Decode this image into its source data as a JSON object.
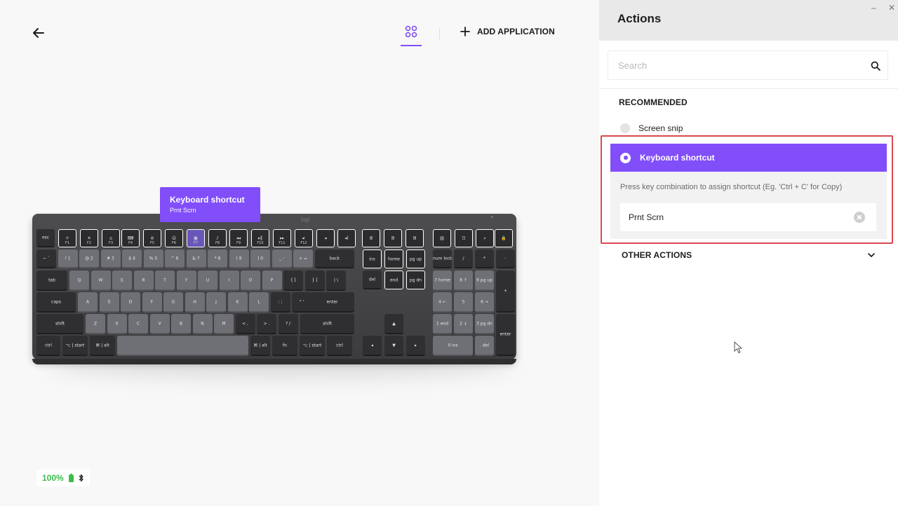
{
  "header": {
    "add_application_label": "ADD APPLICATION"
  },
  "battery": {
    "percent": "100%",
    "color": "#3cbc4c"
  },
  "keyboard": {
    "brand_logo": "logi",
    "tooltip": {
      "title": "Keyboard shortcut",
      "subtitle": "Prnt Scrn"
    },
    "rows": {
      "fn": [
        {
          "label": "esc",
          "style": "dark"
        },
        {
          "label": "☼",
          "sub": "F1",
          "style": "hl"
        },
        {
          "label": "☀",
          "sub": "F2",
          "style": "hl"
        },
        {
          "label": "⌂",
          "sub": "F3",
          "style": "hl"
        },
        {
          "label": "⌨",
          "sub": "F4",
          "style": "hl"
        },
        {
          "label": "⊘",
          "sub": "F5",
          "style": "hl"
        },
        {
          "label": "☺",
          "sub": "F6",
          "style": "hl"
        },
        {
          "label": "▣",
          "sub": "F7",
          "style": "sel"
        },
        {
          "label": "♪",
          "sub": "F8",
          "style": "hl"
        },
        {
          "label": "◂◂",
          "sub": "F9",
          "style": "hl"
        },
        {
          "label": "▸‖",
          "sub": "F10",
          "style": "hl"
        },
        {
          "label": "▸▸",
          "sub": "F11",
          "style": "hl"
        },
        {
          "label": "◂·",
          "sub": "F12",
          "style": "hl"
        },
        {
          "label": "◂",
          "style": "hl"
        },
        {
          "label": "◂)",
          "style": "hl"
        },
        {
          "label": "⊞",
          "style": "hl"
        },
        {
          "label": "⊞",
          "style": "hl"
        },
        {
          "label": "⊞",
          "style": "hl"
        },
        {
          "label": "▥",
          "style": "hl"
        },
        {
          "label": "⊡",
          "style": "hl"
        },
        {
          "label": "⌕",
          "style": "hl"
        },
        {
          "label": "🔒",
          "style": "hl"
        }
      ],
      "num": [
        "~ `",
        "! 1",
        "@ 2",
        "# 3",
        "$ 4",
        "% 5",
        "^ 6",
        "& 7",
        "* 8",
        "( 9",
        ") 0",
        "_ -",
        "+ ="
      ],
      "num_back": "back",
      "nav1": [
        "ins",
        "home",
        "pg up"
      ],
      "pad1": [
        "num lock",
        "/",
        "*",
        "-"
      ],
      "tab": "tab",
      "qwerty": [
        "Q",
        "W",
        "E",
        "R",
        "T",
        "Y",
        "U",
        "I",
        "O",
        "P",
        "{ [",
        "} ]",
        "| \\"
      ],
      "nav2": [
        "del",
        "end",
        "pg dn"
      ],
      "pad2": [
        "7 home",
        "8 ↑",
        "9 pg up",
        "+"
      ],
      "caps": "caps",
      "asdf": [
        "A",
        "S",
        "D",
        "F",
        "G",
        "H",
        "J",
        "K",
        "L",
        ": ;",
        "\" '"
      ],
      "enter": "enter",
      "pad3": [
        "4 ←",
        "5",
        "6 →"
      ],
      "shift_l": "shift",
      "zxcv": [
        "Z",
        "X",
        "C",
        "V",
        "B",
        "N",
        "M",
        "< ,",
        "> .",
        "? /"
      ],
      "shift_r": "shift",
      "arrow_up": "▲",
      "pad4": [
        "1 end",
        "2 ↓",
        "3 pg dn",
        "enter"
      ],
      "bottom": [
        "ctrl",
        "⌥ | start",
        "⌘ | alt",
        "",
        "⌘ | alt",
        "fn",
        "⌥ | start",
        "ctrl"
      ],
      "arrows": [
        "◂",
        "▼",
        "▸"
      ],
      "pad5": [
        "0 ins",
        ". del"
      ]
    }
  },
  "panel": {
    "title": "Actions",
    "window_minimize": "–",
    "window_close": "✕",
    "search": {
      "placeholder": "Search",
      "value": ""
    },
    "recommended_label": "RECOMMENDED",
    "screen_snip_label": "Screen snip",
    "keyboard_shortcut": {
      "label": "Keyboard shortcut",
      "hint": "Press key combination to assign shortcut (Eg. 'Ctrl + C' for Copy)",
      "value": "Prnt Scrn"
    },
    "other_actions_label": "OTHER ACTIONS",
    "accent_color": "#814EFA",
    "highlight_color": "#d8494f"
  }
}
